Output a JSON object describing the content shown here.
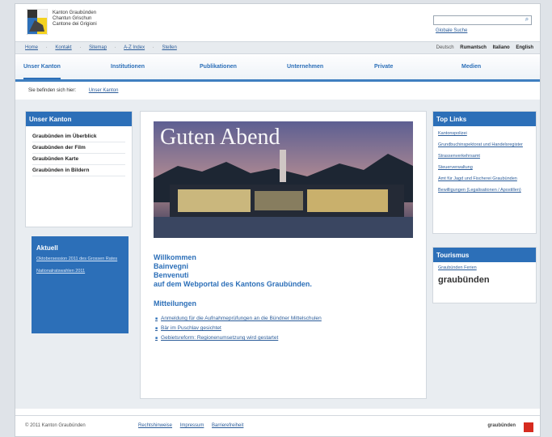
{
  "header": {
    "site_name_lines": [
      "Kanton Graubünden",
      "Chantun Grischun",
      "Cantone dei Grigioni"
    ],
    "search_placeholder": "",
    "global_search_label": "Globale Suche"
  },
  "utilbar": {
    "links": [
      "Home",
      "Kontakt",
      "Sitemap",
      "A-Z Index",
      "Stellen"
    ],
    "separator": "·",
    "languages": [
      {
        "label": "Deutsch",
        "style": "muted"
      },
      {
        "label": "Rumantsch",
        "style": "bold"
      },
      {
        "label": "Italiano",
        "style": "bold"
      },
      {
        "label": "English",
        "style": "bold"
      }
    ]
  },
  "mainnav": {
    "items": [
      "Unser Kanton",
      "Institutionen",
      "Publikationen",
      "Unternehmen",
      "Private",
      "Medien"
    ],
    "active_index": 0
  },
  "breadcrumb": {
    "prefix": "Sie befinden sich hier:",
    "current": "Unser Kanton"
  },
  "left_menu": {
    "title": "Unser Kanton",
    "items": [
      "Graubünden im Überblick",
      "Graubünden der Film",
      "Graubünden Karte",
      "Graubünden in Bildern"
    ]
  },
  "aktuell": {
    "title": "Aktuell",
    "items": [
      "Oktobersession 2011 des Grossen Rates",
      "Nationalratswahlen 2011"
    ]
  },
  "center": {
    "hero_title": "Guten Abend",
    "welcome_lines": [
      "Willkommen",
      "Bainvegni",
      "Benvenuti",
      "auf dem Webportal des Kantons Graubünden."
    ],
    "mitteilungen_title": "Mitteilungen",
    "mitteilungen": [
      "Anmeldung für die Aufnahmeprüfungen an die Bündner Mittelschulen",
      "Bär im Puschlav gesichtet",
      "Gebietsreform: Regionenumsetzung wird gestartet"
    ]
  },
  "toplinks": {
    "title": "Top Links",
    "items": [
      "Kantonspolizei",
      "Grundbuchinspektorat und Handelsregister",
      "Strassenverkehrsamt",
      "Steuerverwaltung",
      "Amt für Jagd und Fischerei Graubünden",
      "Bewilligungen (Legalisationen / Apostillen)"
    ]
  },
  "tourismus": {
    "title": "Tourismus",
    "link": "Graubünden Ferien",
    "logo_text": "graubünden"
  },
  "footer": {
    "copyright": "© 2011 Kanton Graubünden",
    "links": [
      "Rechtshinweise",
      "Impressum",
      "Barrierefreiheit"
    ],
    "logo_text": "graubünden"
  },
  "colors": {
    "accent": "#2c6fb8",
    "footer_badge": "#d62b1f"
  }
}
